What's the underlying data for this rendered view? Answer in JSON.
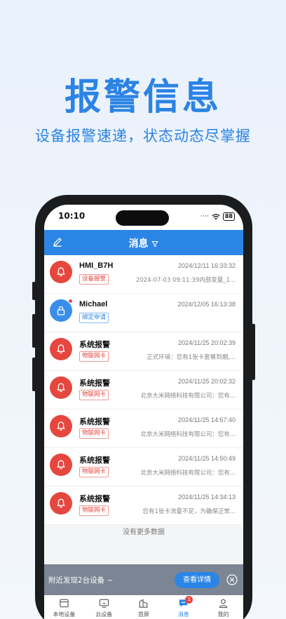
{
  "hero": {
    "title": "报警信息",
    "subtitle": "设备报警速递，状态动态尽掌握"
  },
  "statusbar": {
    "time": "10:10",
    "battery": "88"
  },
  "header": {
    "title": "消息"
  },
  "messages": [
    {
      "name": "HMI_B7H",
      "date": "2024/12/11 16:33:32",
      "tag": "设备报警",
      "preview": "2024-07-03 09:11:39内部变量_1...",
      "avatar": "bell-icon",
      "unread": false
    },
    {
      "name": "Michael",
      "date": "2024/12/05 16:13:38",
      "tag": "绑定申请",
      "preview": "",
      "avatar": "lock-icon",
      "unread": true
    },
    {
      "name": "系统报警",
      "date": "2024/11/25 20:02:39",
      "tag": "物联网卡",
      "preview": "正式环境：您有1张卡套餐到期,...",
      "avatar": "bell-icon",
      "unread": false
    },
    {
      "name": "系统报警",
      "date": "2024/11/25 20:02:32",
      "tag": "物联网卡",
      "preview": "北京大米网络科技有限公司：您有...",
      "avatar": "bell-icon",
      "unread": false
    },
    {
      "name": "系统报警",
      "date": "2024/11/25 14:57:40",
      "tag": "物联网卡",
      "preview": "北京大米网络科技有限公司：您有...",
      "avatar": "bell-icon",
      "unread": false
    },
    {
      "name": "系统报警",
      "date": "2024/11/25 14:50:49",
      "tag": "物联网卡",
      "preview": "北京大米网络科技有限公司：您有...",
      "avatar": "bell-icon",
      "unread": false
    },
    {
      "name": "系统报警",
      "date": "2024/11/25 14:34:13",
      "tag": "物联网卡",
      "preview": "您有1张卡流量不足，为确保正常...",
      "avatar": "bell-icon",
      "unread": false
    }
  ],
  "list_footer": "没有更多数据",
  "toast": {
    "text": "附近发现2台设备 ~",
    "button": "查看详情"
  },
  "tabs": [
    {
      "label": "本地设备",
      "icon": "local-device-icon"
    },
    {
      "label": "云设备",
      "icon": "cloud-device-icon"
    },
    {
      "label": "首屏",
      "icon": "home-screen-icon"
    },
    {
      "label": "消息",
      "icon": "message-icon",
      "badge": "1"
    },
    {
      "label": "我的",
      "icon": "profile-icon"
    }
  ],
  "colors": {
    "accent": "#2b85e6",
    "alert": "#e5473f"
  }
}
